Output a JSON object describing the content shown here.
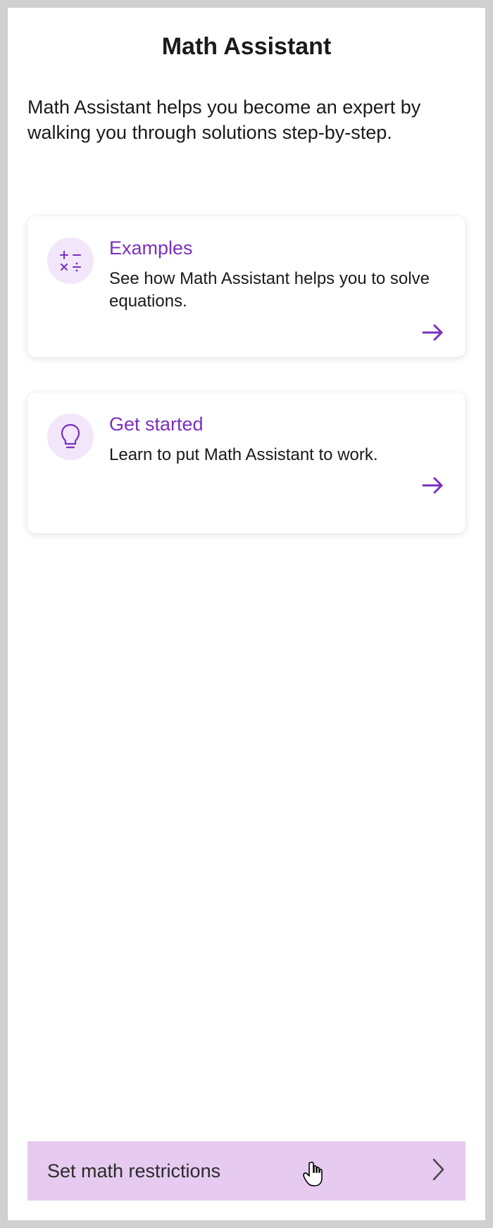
{
  "header": {
    "title": "Math Assistant",
    "description": "Math Assistant helps you become an expert by walking you through solutions step-by-step."
  },
  "cards": {
    "examples": {
      "title": "Examples",
      "description": "See how Math Assistant helps you to solve equations."
    },
    "getStarted": {
      "title": "Get started",
      "description": "Learn to put Math Assistant to work."
    }
  },
  "footer": {
    "restrictions_label": "Set math restrictions"
  },
  "colors": {
    "accent": "#7a2fbf",
    "icon_bg": "#f2e6fa",
    "footer_bg": "#e6caf0"
  }
}
